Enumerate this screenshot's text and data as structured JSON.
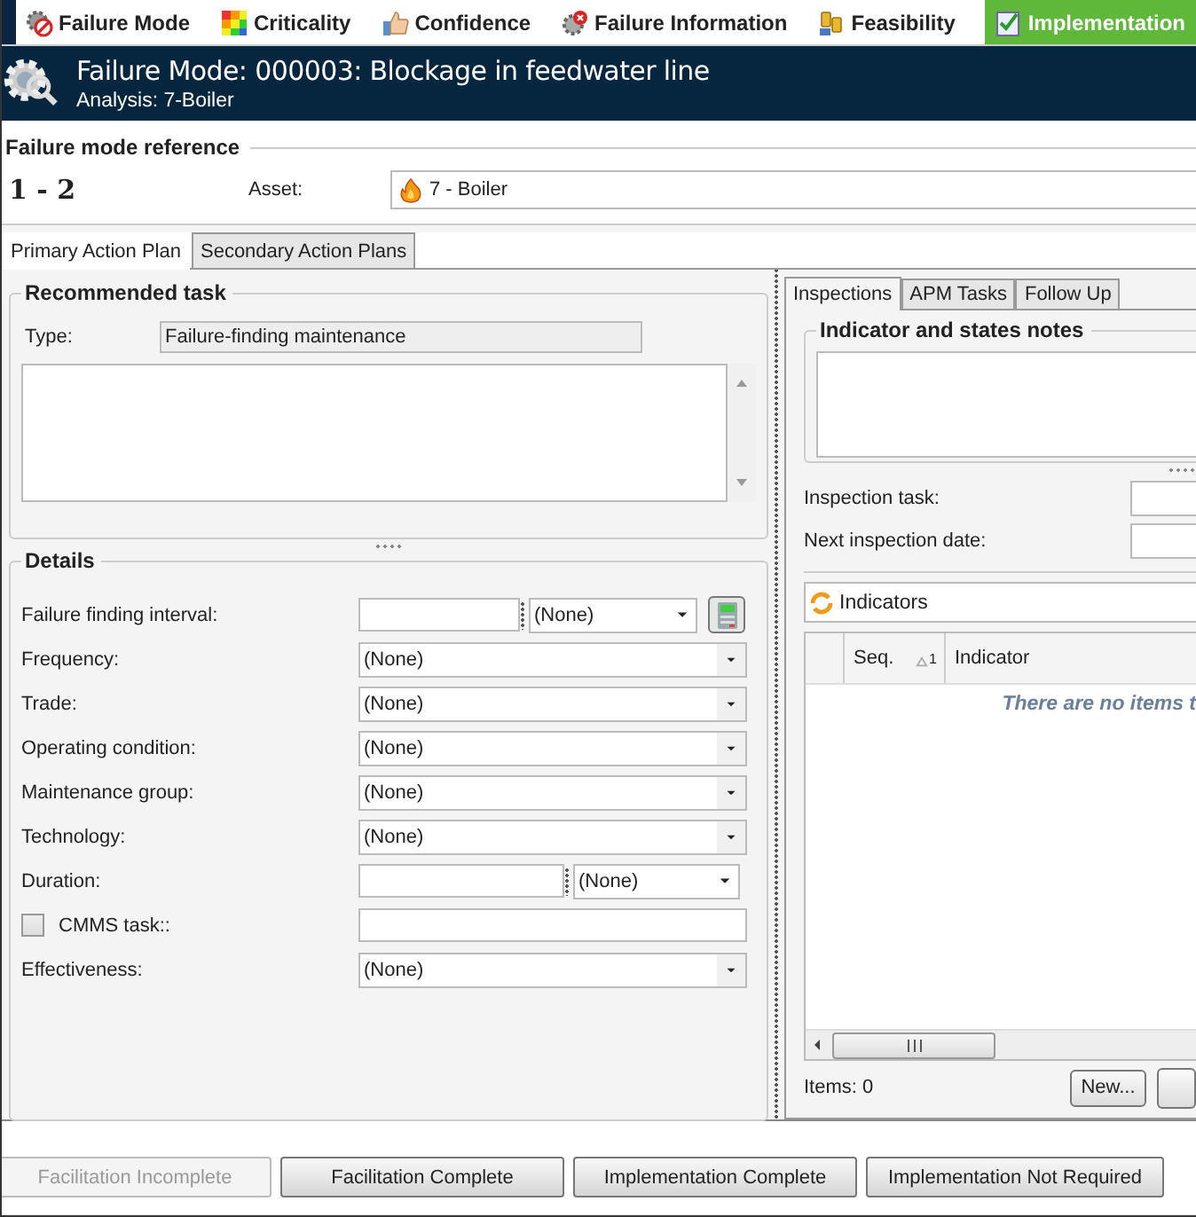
{
  "toolbar": {
    "tabs": [
      {
        "label": "Failure Mode",
        "kind": "gear-stop",
        "selected": false
      },
      {
        "label": "Criticality",
        "kind": "grid",
        "selected": false
      },
      {
        "label": "Confidence",
        "kind": "thumb",
        "selected": false
      },
      {
        "label": "Failure Information",
        "kind": "gear-alert",
        "selected": false
      },
      {
        "label": "Feasibility",
        "kind": "coins",
        "selected": false
      },
      {
        "label": "Implementation",
        "kind": "check",
        "selected": true
      }
    ]
  },
  "header": {
    "title": "Failure Mode: 000003: Blockage in feedwater line",
    "subtitle": "Analysis: 7-Boiler"
  },
  "reference": {
    "heading": "Failure mode reference",
    "number": "1 - 2",
    "asset_label": "Asset:",
    "asset_value": "7 - Boiler"
  },
  "plan_tabs": [
    {
      "label": "Primary Action Plan",
      "selected": true
    },
    {
      "label": "Secondary Action Plans",
      "selected": false
    }
  ],
  "recommended_task": {
    "heading": "Recommended task",
    "type_label": "Type:",
    "type_value": "Failure-finding maintenance"
  },
  "details": {
    "heading": "Details",
    "rows": [
      {
        "kind": "interval",
        "label": "Failure finding interval:",
        "value": "(None)"
      },
      {
        "kind": "select",
        "label": "Frequency:",
        "value": "(None)"
      },
      {
        "kind": "select",
        "label": "Trade:",
        "value": "(None)"
      },
      {
        "kind": "select",
        "label": "Operating condition:",
        "value": "(None)"
      },
      {
        "kind": "select",
        "label": "Maintenance group:",
        "value": "(None)"
      },
      {
        "kind": "select",
        "label": "Technology:",
        "value": "(None)"
      },
      {
        "kind": "duration",
        "label": "Duration:",
        "value": "(None)"
      },
      {
        "kind": "checkbox",
        "label": "CMMS task::",
        "checked": false
      },
      {
        "kind": "select",
        "label": "Effectiveness:",
        "value": "(None)"
      }
    ]
  },
  "right_tabs": [
    {
      "label": "Inspections",
      "selected": true
    },
    {
      "label": "APM Tasks",
      "selected": false
    },
    {
      "label": "Follow Up",
      "selected": false
    }
  ],
  "inspections": {
    "notes_heading": "Indicator and states notes",
    "inspection_task_label": "Inspection task:",
    "next_date_label": "Next inspection date:",
    "indicators_title": "Indicators",
    "columns": [
      {
        "label": "Seq.",
        "sort": "1"
      },
      {
        "label": "Indicator"
      }
    ],
    "empty_text": "There are no items t",
    "items_count": "Items: 0",
    "new_button": "New..."
  },
  "footer_buttons": [
    {
      "label": "Facilitation Incomplete",
      "disabled": true
    },
    {
      "label": "Facilitation Complete",
      "disabled": false
    },
    {
      "label": "Implementation Complete",
      "disabled": false
    },
    {
      "label": "Implementation Not Required",
      "disabled": false
    }
  ]
}
